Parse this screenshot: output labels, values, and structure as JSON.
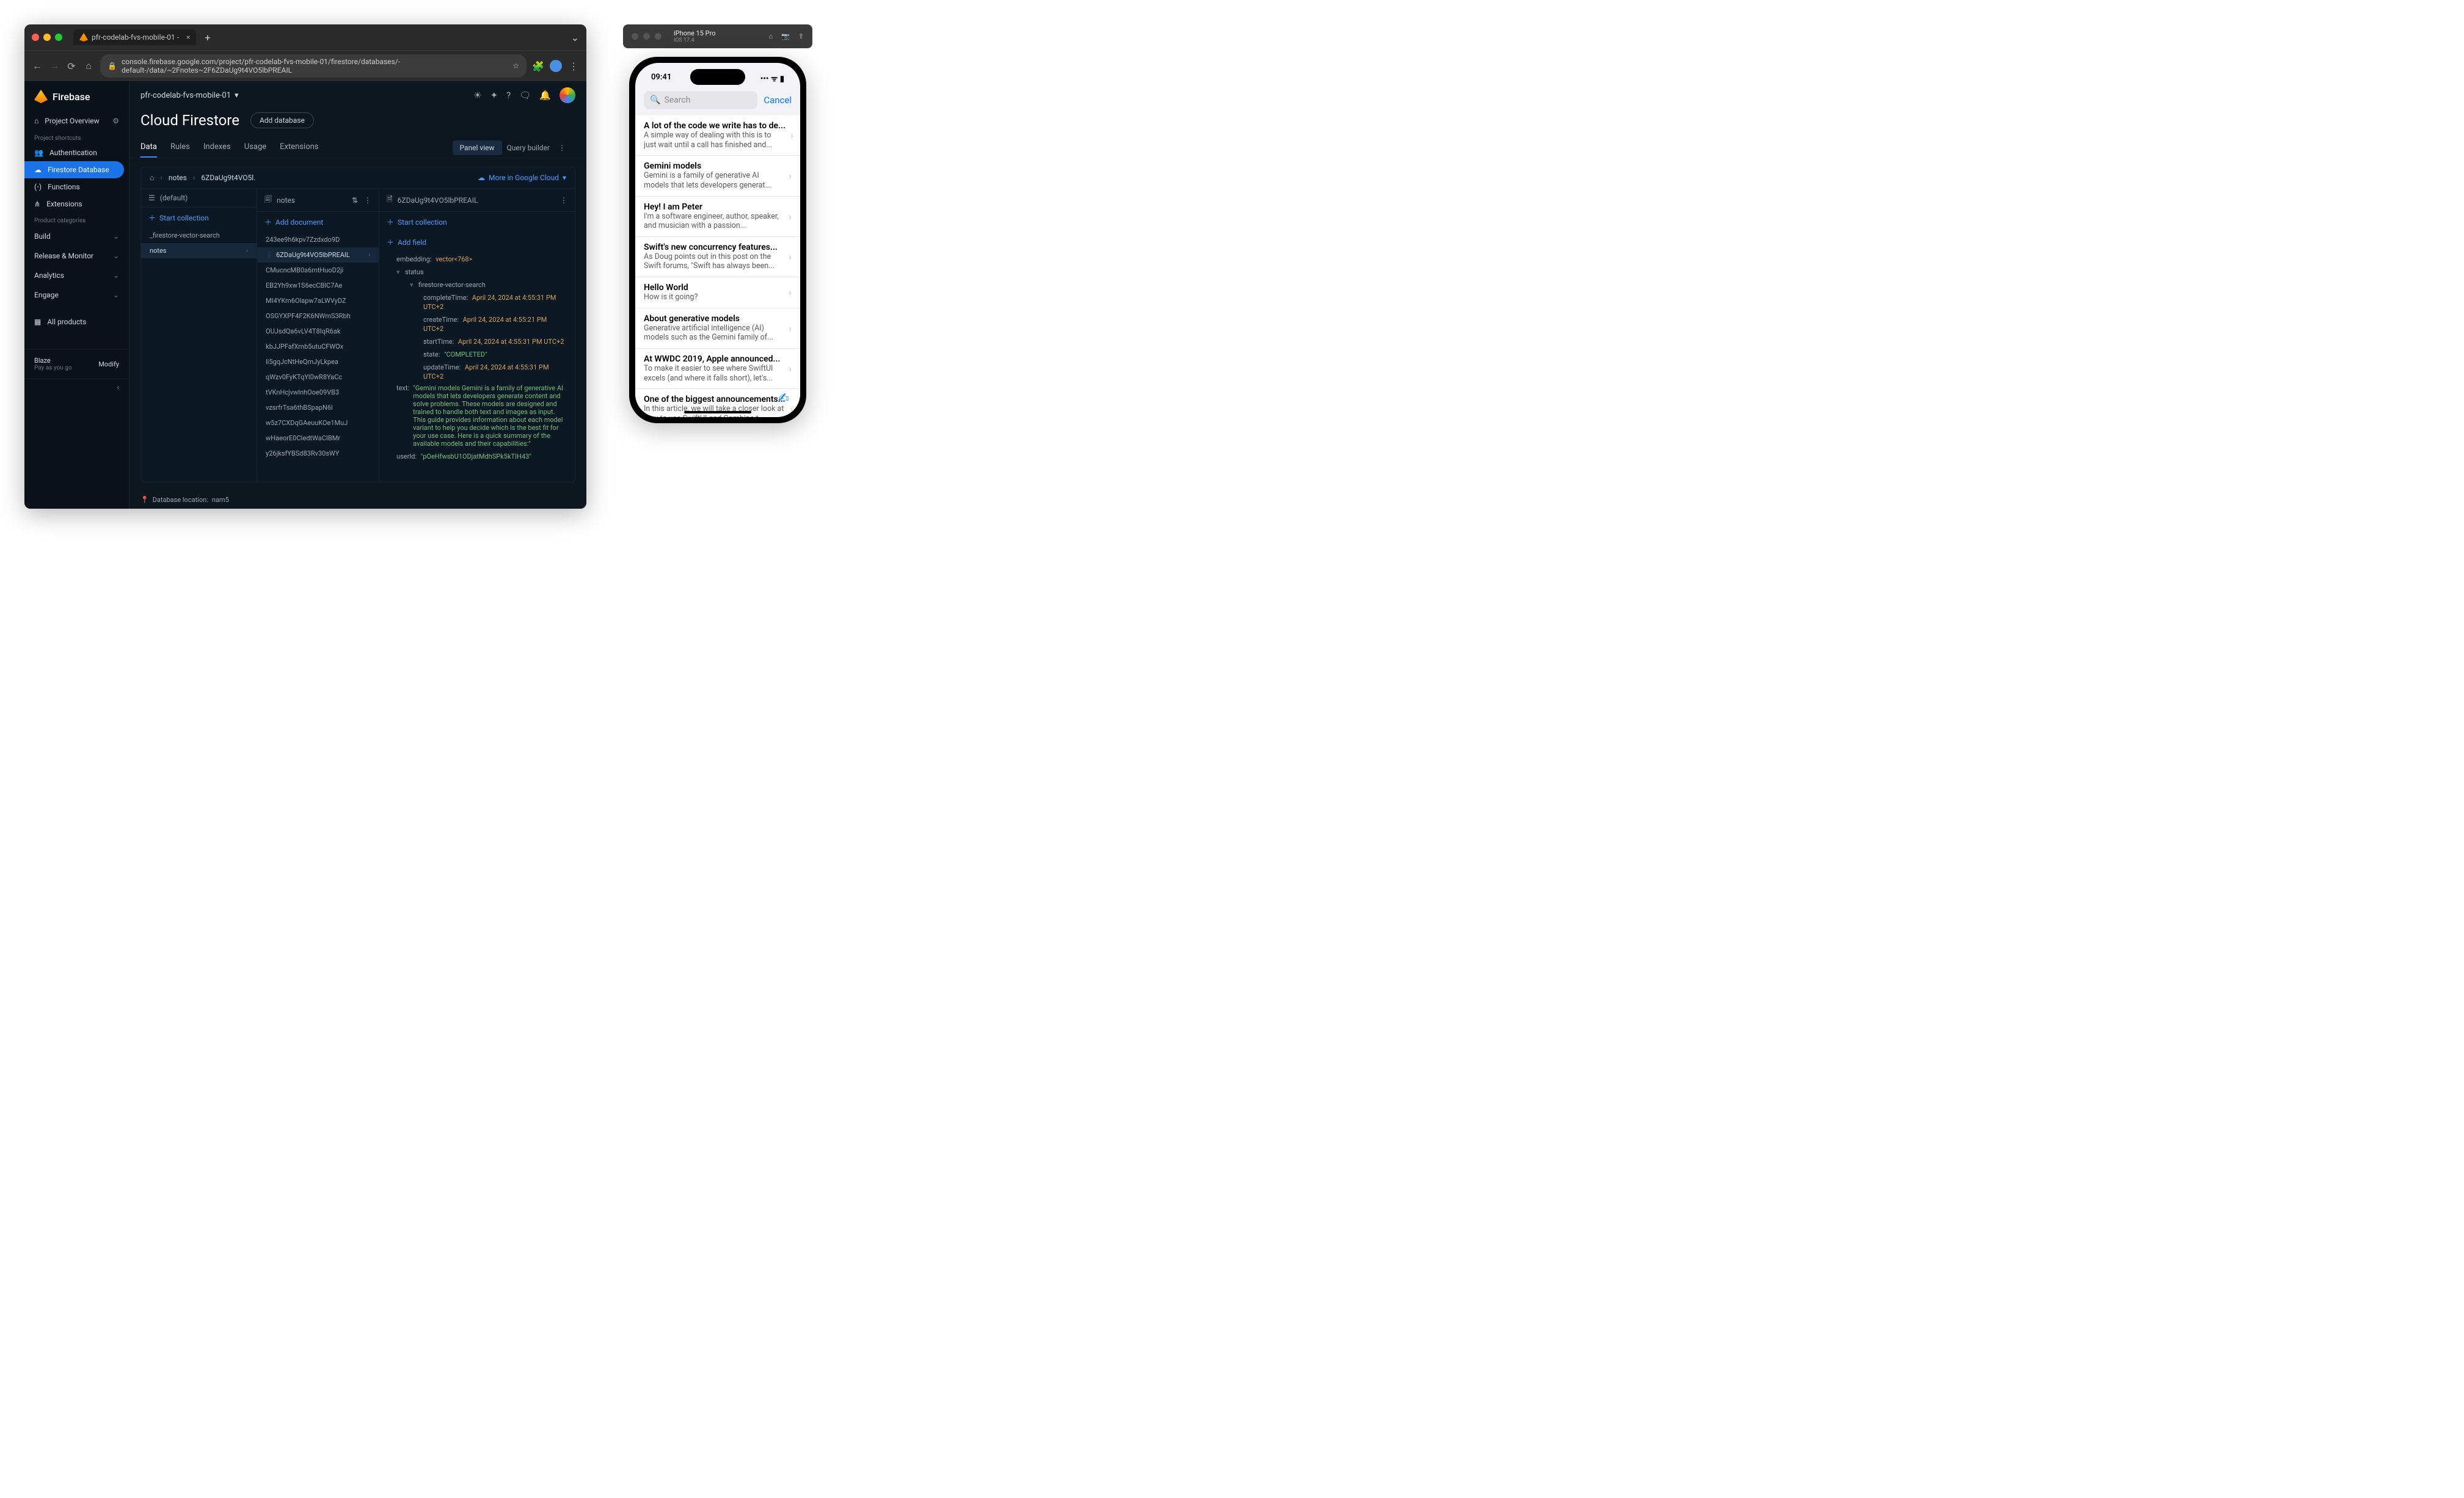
{
  "browser": {
    "tab_title": "pfr-codelab-fvs-mobile-01 - ",
    "url": "console.firebase.google.com/project/pfr-codelab-fvs-mobile-01/firestore/databases/-default-/data/~2Fnotes~2F6ZDaUg9t4VO5lbPREAIL"
  },
  "firebase": {
    "brand": "Firebase",
    "project_overview": "Project Overview",
    "shortcuts_label": "Project shortcuts",
    "shortcuts": [
      {
        "label": "Authentication"
      },
      {
        "label": "Firestore Database"
      },
      {
        "label": "Functions"
      },
      {
        "label": "Extensions"
      }
    ],
    "categories_label": "Product categories",
    "categories": [
      {
        "label": "Build"
      },
      {
        "label": "Release & Monitor"
      },
      {
        "label": "Analytics"
      },
      {
        "label": "Engage"
      }
    ],
    "all_products": "All products",
    "plan_name": "Blaze",
    "plan_sub": "Pay as you go",
    "modify": "Modify",
    "project_name": "pfr-codelab-fvs-mobile-01",
    "page_title": "Cloud Firestore",
    "add_db": "Add database",
    "tabs": [
      "Data",
      "Rules",
      "Indexes",
      "Usage",
      "Extensions"
    ],
    "panel_view": "Panel view",
    "query_builder": "Query builder",
    "path": {
      "root": "notes",
      "doc": "6ZDaUg9t4VO5l."
    },
    "more_gc": "More in Google Cloud",
    "col1": {
      "head": "(default)",
      "action": "Start collection",
      "items": [
        "_firestore-vector-search",
        "notes"
      ]
    },
    "col2": {
      "head": "notes",
      "action": "Add document",
      "items": [
        "243ee9h6kpv7Zzdxdo9D",
        "6ZDaUg9t4VO5lbPREAIL",
        "CMucncMB0a6mtHuoD2ji",
        "EB2Yh9xw1S6ecCBlC7Ae",
        "MI4YKm6Olapw7aLWVyDZ",
        "OSGYXPF4F2K6NWmS3Rbh",
        "OUJsdQa6vLV4T8IqR6ak",
        "kbJJPFafXmb5utuCFWOx",
        "li5gqJcNtHeQmJyLkpea",
        "qWzv0FyKTqYl0wR8YaCc",
        "tVKnHcjvwlnhOoe09VB3",
        "vzsrfrTsa6thBSpapN6l",
        "w5z7CXDqGAeuuKOe1MuJ",
        "wHaeorE0CIedtWaCIBMr",
        "y26jksfYBSd83Rv30sWY"
      ]
    },
    "col3": {
      "head": "6ZDaUg9t4VO5lbPREAIL",
      "action": "Start collection",
      "add_field": "Add field"
    },
    "doc": {
      "embedding": {
        "label": "embedding",
        "value": "vector<768>"
      },
      "status": {
        "label": "status",
        "fvs": "firestore-vector-search",
        "completeTime": "April 24, 2024 at 4:55:31 PM UTC+2",
        "createTime": "April 24, 2024 at 4:55:21 PM UTC+2",
        "startTime": "April 24, 2024 at 4:55:31 PM UTC+2",
        "state": "\"COMPLETED\"",
        "updateTime": "April 24, 2024 at 4:55:31 PM UTC+2"
      },
      "text": {
        "label": "text",
        "value": "\"Gemini models Gemini is a family of generative AI models that lets developers generate content and solve problems. These models are designed and trained to handle both text and images as input. This guide provides information about each model variant to help you decide which is the best fit for your use case. Here is a quick summary of the available models and their capabilities:\""
      },
      "userId": {
        "label": "userId",
        "value": "\"pOeHfwsbU1ODjatMdhSPk5kTIH43\""
      }
    },
    "db_location_label": "Database location:",
    "db_location": "nam5"
  },
  "sim": {
    "device": "iPhone 15 Pro",
    "os": "iOS 17.4",
    "time": "09:41",
    "search_placeholder": "Search",
    "cancel": "Cancel",
    "notes": [
      {
        "title": "A lot of the code we write has to de...",
        "preview": "A simple way of dealing with this is to just wait until a call has finished and..."
      },
      {
        "title": "Gemini models",
        "preview": "Gemini is a family of generative AI models that lets developers generat..."
      },
      {
        "title": "Hey! I am Peter",
        "preview": "I'm a software engineer, author, speaker, and musician with a passion..."
      },
      {
        "title": "Swift's new concurrency features...",
        "preview": "As Doug points out in this post on the Swift forums, \"Swift has always been..."
      },
      {
        "title": "Hello World",
        "preview": "How is it going?"
      },
      {
        "title": "About generative models",
        "preview": "Generative artificial intelligence (AI) models such as the Gemini family of..."
      },
      {
        "title": "At WWDC 2019, Apple announced...",
        "preview": "To make it easier to see where SwiftUI excels (and where it falls short), let's..."
      },
      {
        "title": "One of the biggest announcements...",
        "preview": "In this article, we will take a closer look at how to use SwiftUI and Combine t..."
      }
    ]
  }
}
